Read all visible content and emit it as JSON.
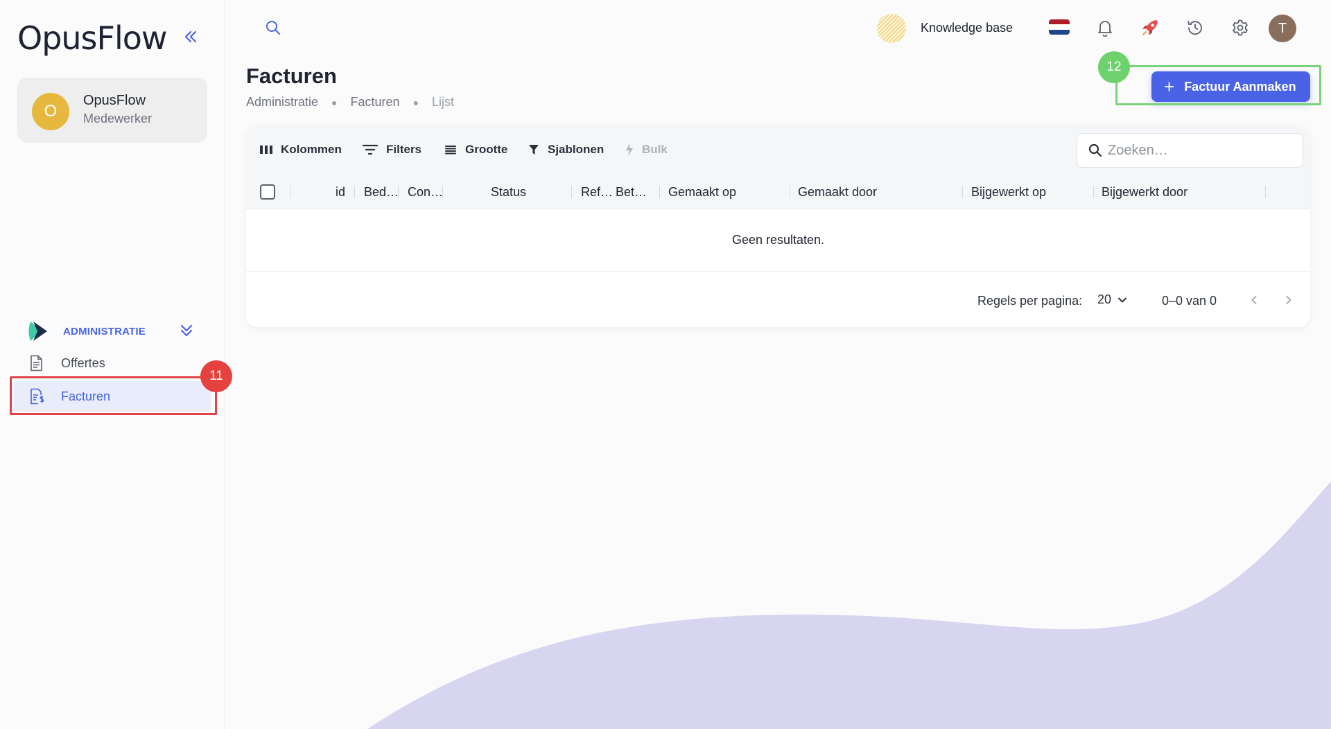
{
  "brand": {
    "logo": "OpusFlow"
  },
  "user": {
    "initial": "O",
    "name": "OpusFlow",
    "role": "Medewerker"
  },
  "sidebar": {
    "section": {
      "label": "ADMINISTRATIE"
    },
    "items": [
      {
        "label": "Offertes",
        "icon": "document-icon"
      },
      {
        "label": "Facturen",
        "icon": "invoice-icon",
        "active": true
      }
    ]
  },
  "topbar": {
    "knowledge_base": "Knowledge base",
    "avatar_initial": "T"
  },
  "page": {
    "title": "Facturen",
    "breadcrumb": [
      "Administratie",
      "Facturen",
      "Lijst"
    ],
    "create_button": "Factuur Aanmaken"
  },
  "toolbar": {
    "columns": "Kolommen",
    "filters": "Filters",
    "size": "Grootte",
    "templates": "Sjablonen",
    "bulk": "Bulk",
    "search_placeholder": "Zoeken…"
  },
  "table": {
    "headers": [
      "id",
      "Bed…",
      "Con…",
      "Status",
      "Ref…",
      "Bet…",
      "Gemaakt op",
      "Gemaakt door",
      "Bijgewerkt op",
      "Bijgewerkt door"
    ],
    "empty_message": "Geen resultaten."
  },
  "pagination": {
    "rows_label": "Regels per pagina:",
    "rows_value": "20",
    "range": "0–0 van 0"
  },
  "annotations": {
    "step_a": "11",
    "step_b": "12"
  },
  "colors": {
    "accent": "#4a63e6",
    "highlight_red": "#e0414a",
    "highlight_green": "#7ad37a",
    "wave": "#d7d5f0"
  }
}
